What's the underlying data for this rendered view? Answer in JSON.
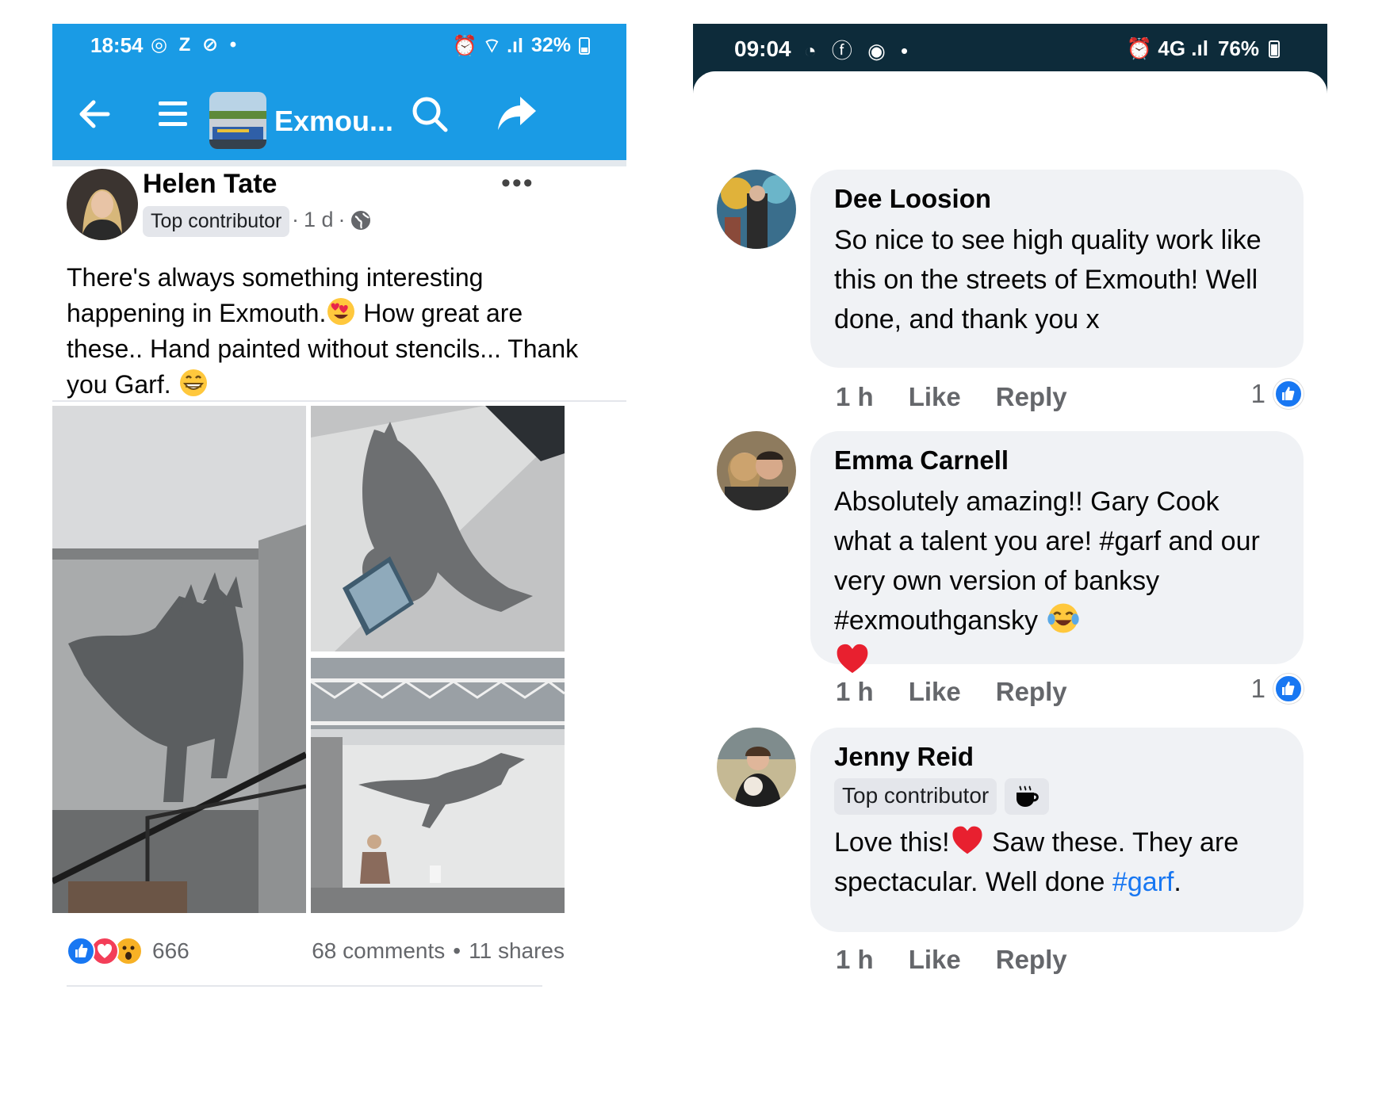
{
  "left_phone": {
    "status_bar": {
      "time": "18:54",
      "left_icons": "◎ Z ⊘ •",
      "signal_icons": "⏰ ⌔ .ıl",
      "battery": "32%"
    },
    "app_bar": {
      "back_icon": "arrow-left",
      "menu_icon": "hamburger",
      "group_name": "Exmou...",
      "search_icon": "search",
      "share_icon": "share-arrow"
    },
    "post": {
      "author": "Helen Tate",
      "badge": "Top contributor",
      "time": "1 d",
      "separator": "·",
      "more": "•••",
      "text_1": "There's always something interesting happening in Exmouth.",
      "text_2": " How great are these.. Hand painted without stencils... Thank you Garf. ",
      "reaction_count": "666",
      "comments": "68 comments",
      "dot": "•",
      "shares": "11 shares"
    },
    "colors": {
      "header": "#1a9be5",
      "like": "#1877f2",
      "love": "#f33e58",
      "wow": "#f7b125"
    }
  },
  "right_phone": {
    "status_bar": {
      "time": "09:04",
      "left_icons": "◔ ⓕ ◉ •",
      "signal_icons": "⏰ 4G .ıl",
      "battery": "76%"
    },
    "comments": [
      {
        "name": "Dee Loosion",
        "text": "So nice to see high quality work like this on the streets of Exmouth! Well done, and thank you x",
        "time": "1 h",
        "like": "Like",
        "reply": "Reply",
        "likes": "1"
      },
      {
        "name": "Emma Carnell",
        "text": "Absolutely amazing!! Gary Cook what a talent you are! #garf and our very own version of banksy #exmouthgansky ",
        "time": "1 h",
        "like": "Like",
        "reply": "Reply",
        "likes": "1"
      },
      {
        "name": "Jenny Reid",
        "badge": "Top contributor",
        "text_1": "Love this!",
        "text_2": " Saw these. They are spectacular. Well done ",
        "hashtag": "#garf",
        "text_3": ".",
        "time": "1 h",
        "like": "Like",
        "reply": "Reply"
      }
    ],
    "colors": {
      "status": "#0d2b3a",
      "bubble": "#f0f2f5",
      "hashtag": "#1877f2"
    }
  }
}
